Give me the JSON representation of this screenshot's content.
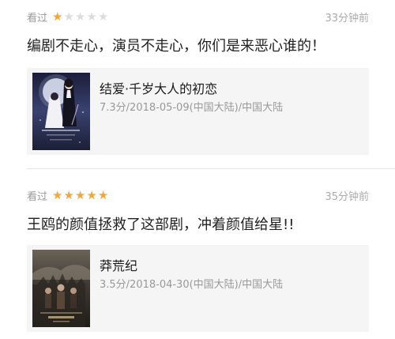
{
  "reviews": [
    {
      "status": "看过",
      "rating": 1,
      "rating_max": 5,
      "time": "33分钟前",
      "comment": "编剧不走心，演员不走心，你们是来恶心谁的！",
      "movie": {
        "title": "结爱·千岁大人的初恋",
        "meta": "7.3分/2018-05-09(中国大陆)/中国大陆"
      }
    },
    {
      "status": "看过",
      "rating": 5,
      "rating_max": 5,
      "time": "35分钟前",
      "comment": "王鸥的颜值拯救了这部剧，冲着颜值给星!!",
      "movie": {
        "title": "莽荒纪",
        "meta": "3.5分/2018-04-30(中国大陆)/中国大陆"
      }
    }
  ],
  "colors": {
    "star_filled": "#f4a63a",
    "star_empty": "#dcdcdc"
  }
}
